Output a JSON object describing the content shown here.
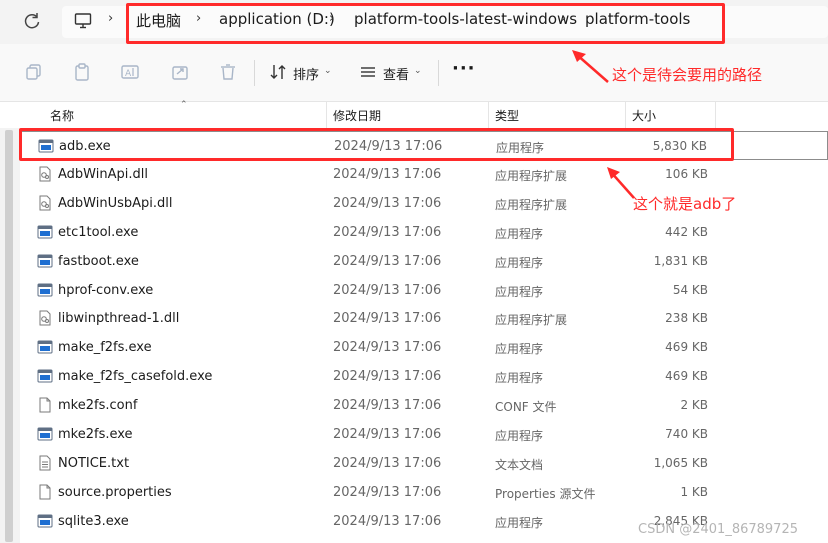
{
  "address": {
    "crumbs": [
      "此电脑",
      "application (D:)",
      "platform-tools-latest-windows",
      "platform-tools"
    ],
    "refresh_icon": "refresh-icon",
    "pc_icon": "computer-icon"
  },
  "toolbar": {
    "sort_label": "排序",
    "view_label": "查看",
    "more_label": "···"
  },
  "columns": {
    "name": "名称",
    "date": "修改日期",
    "type": "类型",
    "size": "大小"
  },
  "files": [
    {
      "name": "adb.exe",
      "date": "2024/9/13 17:06",
      "type": "应用程序",
      "size": "5,830 KB",
      "icon": "exe"
    },
    {
      "name": "AdbWinApi.dll",
      "date": "2024/9/13 17:06",
      "type": "应用程序扩展",
      "size": "106 KB",
      "icon": "dll"
    },
    {
      "name": "AdbWinUsbApi.dll",
      "date": "2024/9/13 17:06",
      "type": "应用程序扩展",
      "size": "",
      "icon": "dll"
    },
    {
      "name": "etc1tool.exe",
      "date": "2024/9/13 17:06",
      "type": "应用程序",
      "size": "442 KB",
      "icon": "exe"
    },
    {
      "name": "fastboot.exe",
      "date": "2024/9/13 17:06",
      "type": "应用程序",
      "size": "1,831 KB",
      "icon": "exe"
    },
    {
      "name": "hprof-conv.exe",
      "date": "2024/9/13 17:06",
      "type": "应用程序",
      "size": "54 KB",
      "icon": "exe"
    },
    {
      "name": "libwinpthread-1.dll",
      "date": "2024/9/13 17:06",
      "type": "应用程序扩展",
      "size": "238 KB",
      "icon": "dll"
    },
    {
      "name": "make_f2fs.exe",
      "date": "2024/9/13 17:06",
      "type": "应用程序",
      "size": "469 KB",
      "icon": "exe"
    },
    {
      "name": "make_f2fs_casefold.exe",
      "date": "2024/9/13 17:06",
      "type": "应用程序",
      "size": "469 KB",
      "icon": "exe"
    },
    {
      "name": "mke2fs.conf",
      "date": "2024/9/13 17:06",
      "type": "CONF 文件",
      "size": "2 KB",
      "icon": "file"
    },
    {
      "name": "mke2fs.exe",
      "date": "2024/9/13 17:06",
      "type": "应用程序",
      "size": "740 KB",
      "icon": "exe"
    },
    {
      "name": "NOTICE.txt",
      "date": "2024/9/13 17:06",
      "type": "文本文档",
      "size": "1,065 KB",
      "icon": "txt"
    },
    {
      "name": "source.properties",
      "date": "2024/9/13 17:06",
      "type": "Properties 源文件",
      "size": "1 KB",
      "icon": "file"
    },
    {
      "name": "sqlite3.exe",
      "date": "2024/9/13 17:06",
      "type": "应用程序",
      "size": "2,845 KB",
      "icon": "exe"
    }
  ],
  "annotations": {
    "path_note": "这个是待会要用的路径",
    "adb_note": "这个就是adb了"
  },
  "watermark": "CSDN @2401_86789725",
  "colors": {
    "annotation": "#ff2a2a",
    "exe_blue": "#1f6fd1"
  }
}
